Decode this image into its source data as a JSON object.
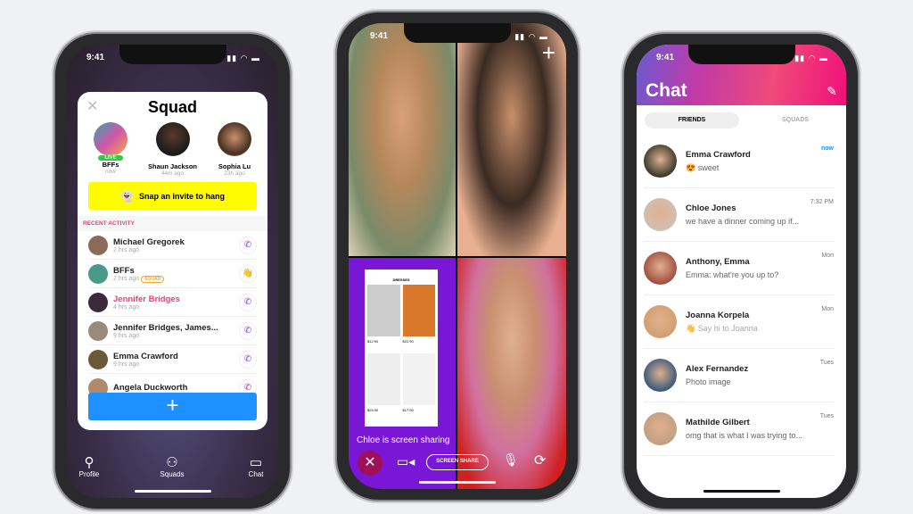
{
  "status_time": "9:41",
  "squad": {
    "title": "Squad",
    "close_icon": "close-icon",
    "featured": [
      {
        "name": "BFFs",
        "sub": "now",
        "badge": "LIVE"
      },
      {
        "name": "Shaun Jackson",
        "sub": "44m ago"
      },
      {
        "name": "Sophia Lu",
        "sub": "23h ago"
      }
    ],
    "invite_label": "Snap an invite to hang",
    "section_label": "RECENT ACTIVITY",
    "activity": [
      {
        "name": "Michael Gregorek",
        "time": "2 hrs ago",
        "action": "call"
      },
      {
        "name": "BFFs",
        "time": "2 hrs ago",
        "tag": "SQUAD",
        "action": "wave"
      },
      {
        "name": "Jennifer Bridges",
        "time": "4 hrs ago",
        "action": "call",
        "highlight": true
      },
      {
        "name": "Jennifer Bridges, James...",
        "time": "9 hrs ago",
        "action": "call"
      },
      {
        "name": "Emma Crawford",
        "time": "9 hrs ago",
        "action": "call"
      },
      {
        "name": "Angela Duckworth",
        "time": "",
        "action": "call"
      }
    ],
    "add_label": "+",
    "nav": [
      {
        "label": "Profile"
      },
      {
        "label": "Squads"
      },
      {
        "label": "Chat"
      }
    ]
  },
  "call": {
    "sharing_text": "Chloe is screen sharing",
    "screen_share_label": "SCREEN SHARE",
    "shared_screen": {
      "header": "DRESSES",
      "prices": [
        "$12.90",
        "$22.90",
        "$25.90",
        "$17.90"
      ]
    }
  },
  "chat": {
    "title": "Chat",
    "tabs": [
      {
        "label": "FRIENDS",
        "active": true
      },
      {
        "label": "SQUADS",
        "active": false
      }
    ],
    "conversations": [
      {
        "name": "Emma Crawford",
        "message": "😍 sweet",
        "time": "now"
      },
      {
        "name": "Chloe Jones",
        "message": "we have a dinner coming up if...",
        "time": "7:32 PM"
      },
      {
        "name": "Anthony, Emma",
        "message": "Emma: what're you up to?",
        "time": "Mon"
      },
      {
        "name": "Joanna Korpela",
        "message": "👋 Say hi to Joanna",
        "time": "Mon"
      },
      {
        "name": "Alex Fernandez",
        "message": "Photo image",
        "time": "Tues"
      },
      {
        "name": "Mathilde Gilbert",
        "message": "omg that is what I was trying to...",
        "time": "Tues"
      }
    ]
  },
  "colors": {
    "accent_blue": "#1e90ff",
    "snap_yellow": "#fffc00",
    "pink": "#f23c78",
    "purple": "#7a16d6"
  }
}
